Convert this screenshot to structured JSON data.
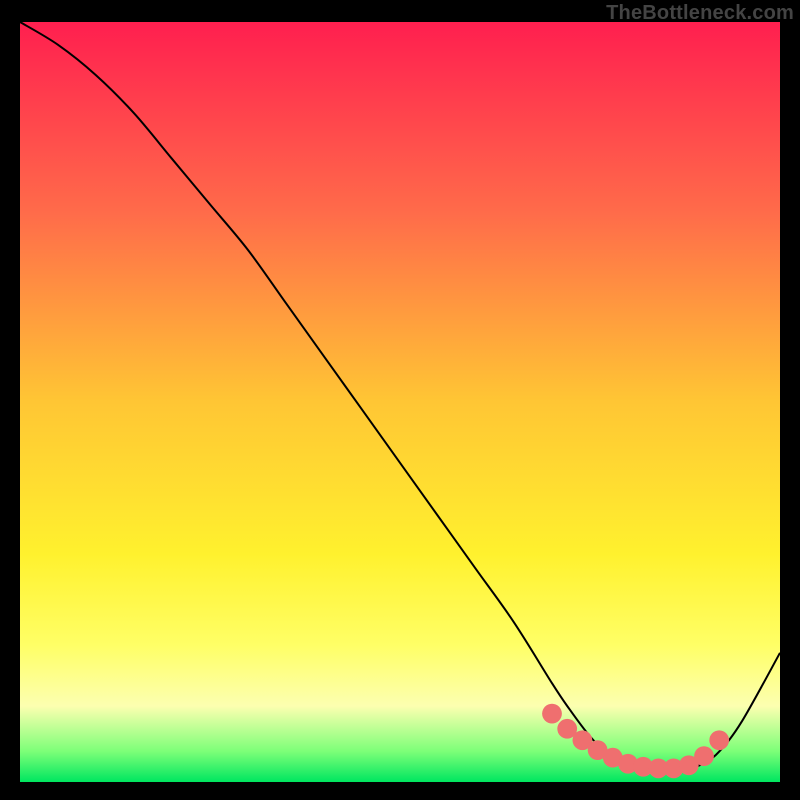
{
  "watermark": "TheBottleneck.com",
  "colors": {
    "frame": "#000000",
    "curve_stroke": "#000000",
    "dot_fill": "#ef6f6f",
    "gradient_stops": [
      {
        "offset": 0.0,
        "color": "#ff1f4f"
      },
      {
        "offset": 0.25,
        "color": "#ff6b4a"
      },
      {
        "offset": 0.5,
        "color": "#ffc634"
      },
      {
        "offset": 0.7,
        "color": "#fff12e"
      },
      {
        "offset": 0.82,
        "color": "#ffff66"
      },
      {
        "offset": 0.9,
        "color": "#fcffb0"
      },
      {
        "offset": 0.96,
        "color": "#7cff78"
      },
      {
        "offset": 1.0,
        "color": "#00e660"
      }
    ]
  },
  "chart_data": {
    "type": "line",
    "title": "",
    "xlabel": "",
    "ylabel": "",
    "xlim": [
      0,
      100
    ],
    "ylim": [
      0,
      100
    ],
    "series": [
      {
        "name": "bottleneck-curve",
        "x": [
          0,
          5,
          10,
          15,
          20,
          25,
          30,
          35,
          40,
          45,
          50,
          55,
          60,
          65,
          70,
          72,
          75,
          78,
          80,
          83,
          86,
          88,
          90,
          92,
          95,
          100
        ],
        "values": [
          100,
          97,
          93,
          88,
          82,
          76,
          70,
          63,
          56,
          49,
          42,
          35,
          28,
          21,
          13,
          10,
          6,
          3,
          2,
          1.6,
          1.5,
          1.7,
          2.5,
          4,
          8,
          17
        ]
      }
    ],
    "highlight_points": {
      "name": "optimal-range-dots",
      "x": [
        70,
        72,
        74,
        76,
        78,
        80,
        82,
        84,
        86,
        88,
        90,
        92
      ],
      "values": [
        9,
        7,
        5.5,
        4.2,
        3.2,
        2.4,
        2.0,
        1.8,
        1.8,
        2.2,
        3.4,
        5.5
      ]
    }
  }
}
